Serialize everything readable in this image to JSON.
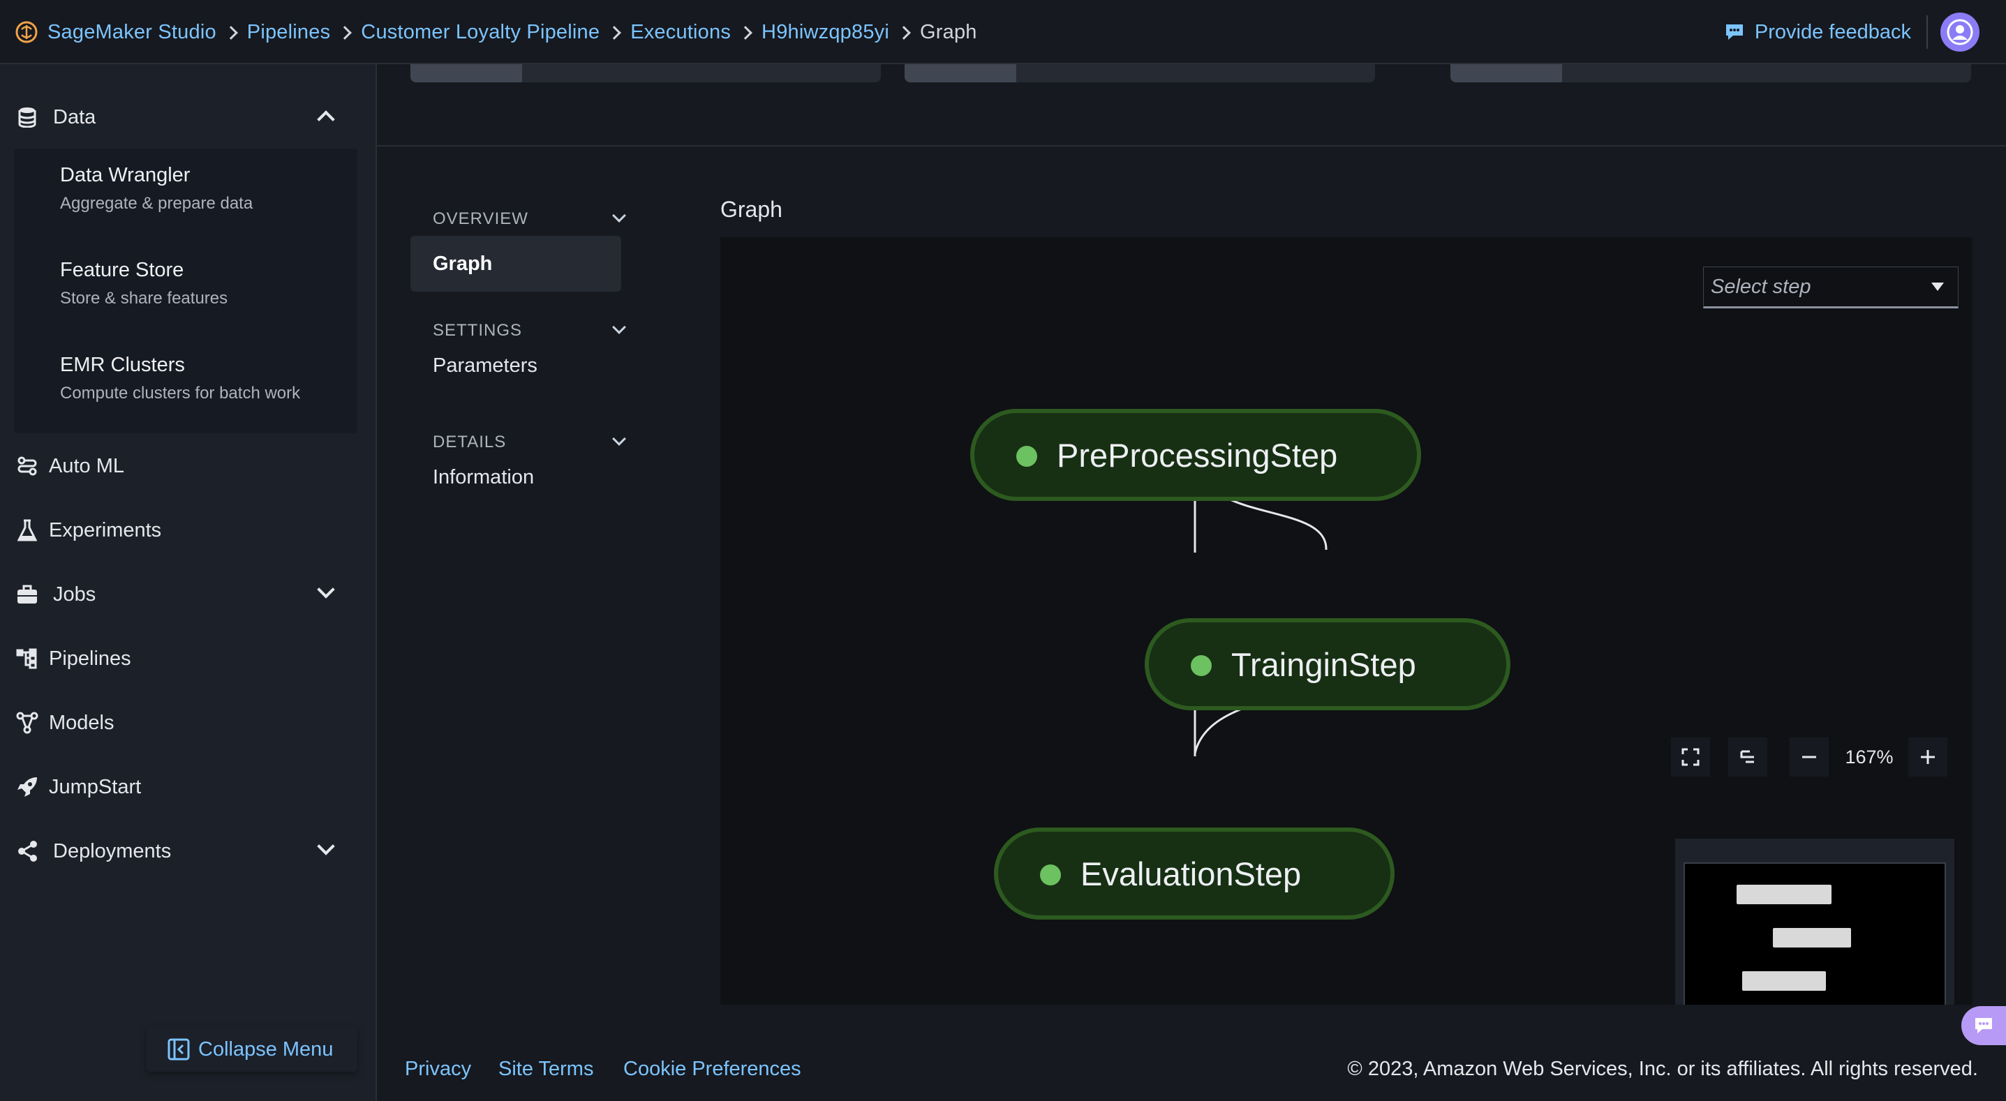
{
  "header": {
    "breadcrumbs": [
      {
        "label": "SageMaker Studio"
      },
      {
        "label": "Pipelines"
      },
      {
        "label": "Customer Loyalty Pipeline"
      },
      {
        "label": "Executions"
      },
      {
        "label": "H9hiwzqp85yi"
      },
      {
        "label": "Graph"
      }
    ],
    "feedback_label": "Provide feedback"
  },
  "sidebar": {
    "data_label": "Data",
    "data_items": [
      {
        "title": "Data Wrangler",
        "desc": "Aggregate & prepare data"
      },
      {
        "title": "Feature Store",
        "desc": "Store & share features"
      },
      {
        "title": "EMR Clusters",
        "desc": "Compute clusters for batch work"
      }
    ],
    "items": [
      {
        "label": "Auto ML",
        "icon": "automl-icon"
      },
      {
        "label": "Experiments",
        "icon": "flask-icon"
      },
      {
        "label": "Jobs",
        "icon": "briefcase-icon"
      },
      {
        "label": "Pipelines",
        "icon": "pipeline-icon"
      },
      {
        "label": "Models",
        "icon": "models-icon"
      },
      {
        "label": "JumpStart",
        "icon": "rocket-icon"
      },
      {
        "label": "Deployments",
        "icon": "share-icon"
      }
    ],
    "collapse_label": "Collapse Menu"
  },
  "subnav": {
    "overview": "OVERVIEW",
    "graph": "Graph",
    "settings": "SETTINGS",
    "parameters": "Parameters",
    "details": "DETAILS",
    "information": "Information"
  },
  "graph": {
    "title": "Graph",
    "select_placeholder": "Select step",
    "nodes": [
      "PreProcessingStep",
      "TrainginStep",
      "EvaluationStep"
    ],
    "zoom": "167%",
    "status_color": "#6cc160"
  },
  "footer": {
    "privacy": "Privacy",
    "site_terms": "Site Terms",
    "cookie_preferences": "Cookie Preferences",
    "copyright": "© 2023, Amazon Web Services, Inc. or its affiliates. All rights reserved."
  },
  "colors": {
    "accent": "#7cc4ff",
    "avatar": "#8b7cf6",
    "node_fill": "#173014",
    "node_border": "#2d5a1f"
  }
}
